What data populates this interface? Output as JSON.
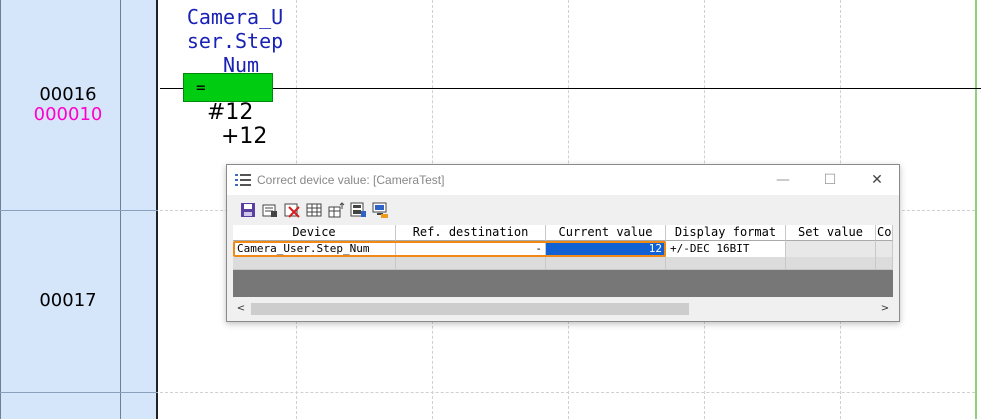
{
  "ladder": {
    "steps": [
      {
        "number": "00016",
        "sub": "000010"
      },
      {
        "number": "00017",
        "sub": ""
      }
    ],
    "device_label": "Camera_User.Step_Num",
    "device_lines": [
      "Camera_U",
      "ser.Step",
      "_Num"
    ],
    "compare_operator": "=",
    "operand_1": "#12",
    "operand_2": "+12",
    "colors": {
      "step_column": "#d6e6fa",
      "compare_box": "#00cc11",
      "device_text": "#1a22b5",
      "sub_step": "#ff00cc"
    }
  },
  "dialog": {
    "title": "Correct device value: [CameraTest]",
    "window_buttons": {
      "minimize": "—",
      "maximize": "☐",
      "close": "✕"
    },
    "toolbar": [
      {
        "name": "save-icon",
        "symbol": "save"
      },
      {
        "name": "register-icon",
        "symbol": "register"
      },
      {
        "name": "delete-icon",
        "symbol": "delete"
      },
      {
        "name": "table-icon",
        "symbol": "table"
      },
      {
        "name": "insert-row-icon",
        "symbol": "insert"
      },
      {
        "name": "monitor-icon",
        "symbol": "monitor"
      },
      {
        "name": "pc-icon",
        "symbol": "pc"
      }
    ],
    "columns": [
      "Device",
      "Ref. destination",
      "Current value",
      "Display format",
      "Set value",
      "Co"
    ],
    "rows": [
      {
        "device": "Camera_User.Step_Num",
        "ref_destination": "-",
        "current_value": "12",
        "display_format": "+/-DEC 16BIT",
        "set_value": ""
      }
    ],
    "colors": {
      "selected_cell": "#1062d4",
      "row_focus": "#ef8a17"
    }
  }
}
